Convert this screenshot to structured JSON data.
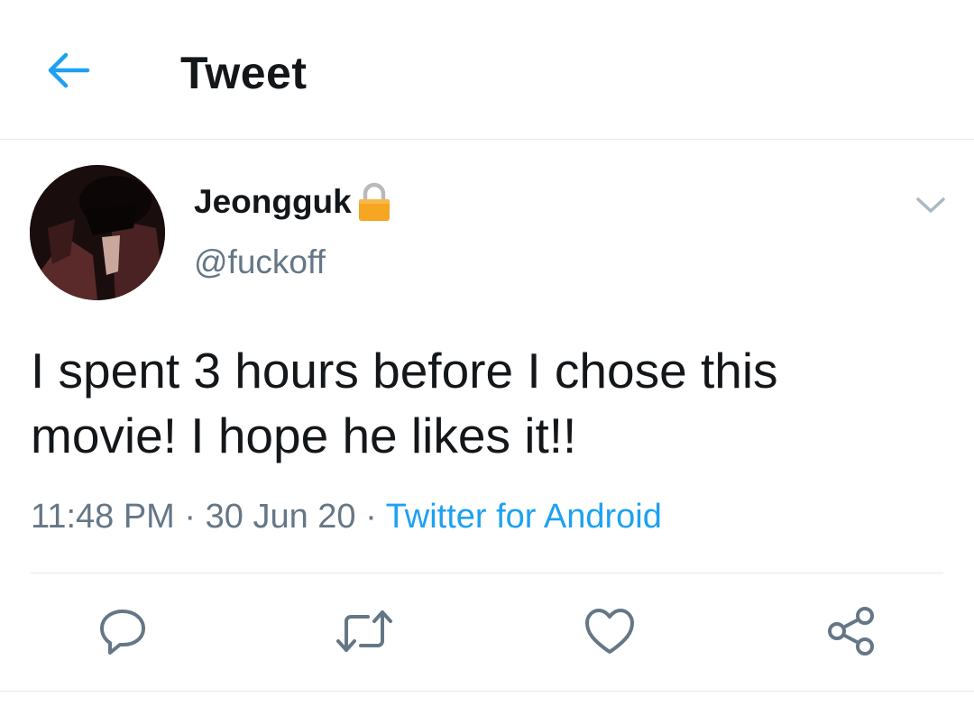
{
  "header": {
    "title": "Tweet",
    "back_icon": "arrow-left-icon"
  },
  "tweet": {
    "author": {
      "display_name": "Jeongguk",
      "handle": "@fuckoff",
      "protected_icon": "lock-icon"
    },
    "text": "I spent 3 hours before I chose this movie! I hope he likes it!!",
    "time": "11:48 PM",
    "separator": "·",
    "date": "30 Jun 20",
    "source": "Twitter for Android",
    "menu_icon": "chevron-down-icon"
  },
  "actions": [
    {
      "name": "reply",
      "icon": "reply-icon"
    },
    {
      "name": "retweet",
      "icon": "retweet-icon"
    },
    {
      "name": "like",
      "icon": "heart-icon"
    },
    {
      "name": "share",
      "icon": "share-icon"
    }
  ],
  "colors": {
    "accent": "#1da1f2",
    "text": "#14171a",
    "secondary_text": "#657786",
    "icon": "#657786",
    "lock": "#f5a623"
  }
}
